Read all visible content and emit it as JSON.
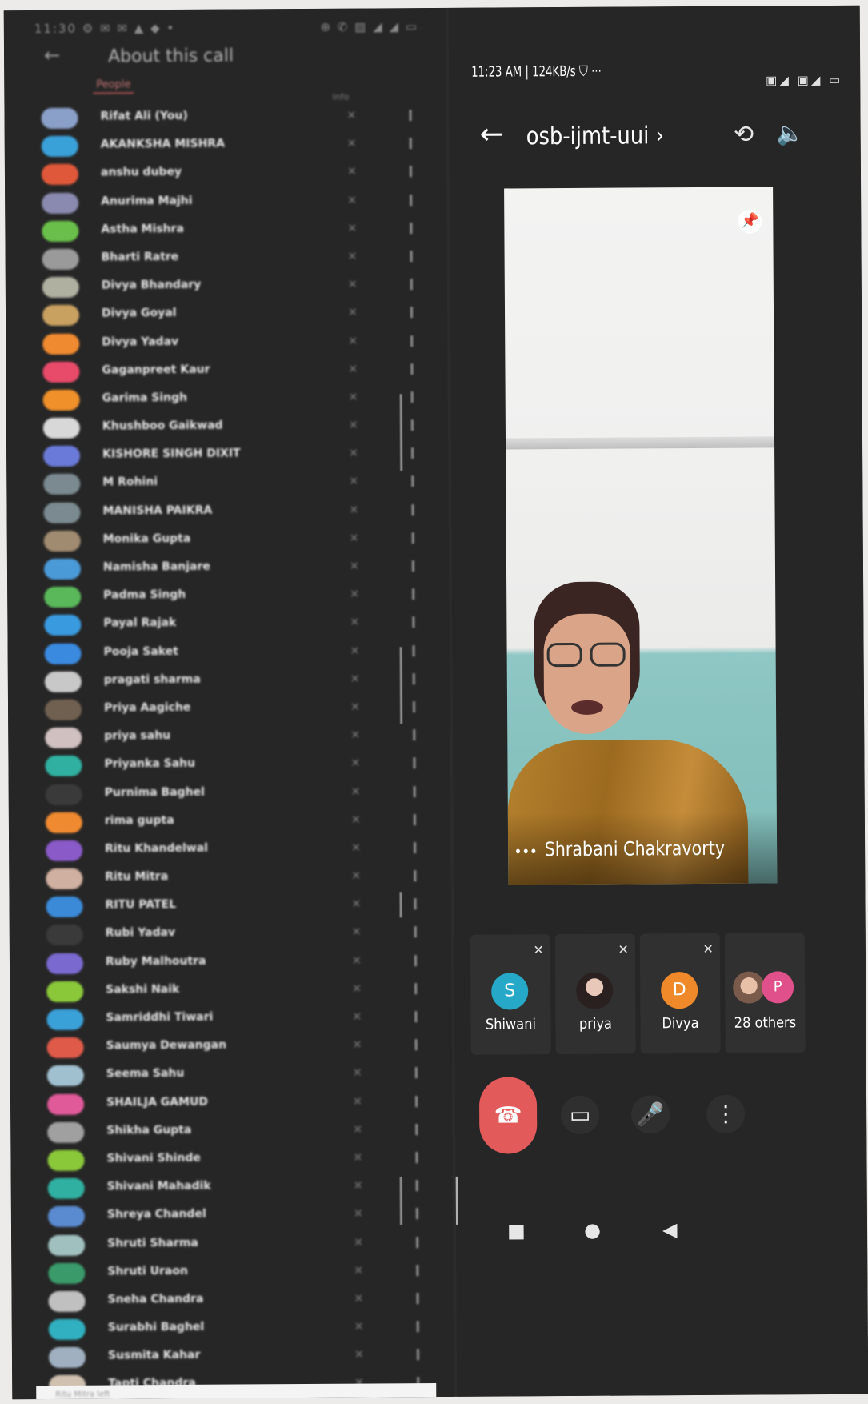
{
  "left_panel": {
    "status_bar": "11:30 ⚙ ✉ ✉ ▲ ◆ •",
    "status_icons": "⊕ ✆ ▨ ◢ ◢ ▭",
    "title": "About this call",
    "tab_people": "People",
    "tab_info": "Info",
    "footer": "Ritu Mitra left",
    "people": [
      {
        "name": "Rifat Ali (You)",
        "color": "#8aa0c8"
      },
      {
        "name": "AKANKSHA MISHRA",
        "color": "#3aa0d8"
      },
      {
        "name": "anshu dubey",
        "color": "#e0583a"
      },
      {
        "name": "Anurima Majhi",
        "color": "#8a8ab0"
      },
      {
        "name": "Astha Mishra",
        "color": "#6abf4a"
      },
      {
        "name": "Bharti Ratre",
        "color": "#9a9a9a"
      },
      {
        "name": "Divya Bhandary",
        "color": "#b0b0a0"
      },
      {
        "name": "Divya Goyal",
        "color": "#c8a060"
      },
      {
        "name": "Divya Yadav",
        "color": "#f08a30"
      },
      {
        "name": "Gaganpreet Kaur",
        "color": "#e84a6a"
      },
      {
        "name": "Garima Singh",
        "color": "#f0902a"
      },
      {
        "name": "Khushboo Gaikwad",
        "color": "#d8d8d8"
      },
      {
        "name": "KISHORE SINGH DIXIT",
        "color": "#6a7ad8"
      },
      {
        "name": "M Rohini",
        "color": "#7a8a90"
      },
      {
        "name": "MANISHA PAIKRA",
        "color": "#7a8a90"
      },
      {
        "name": "Monika Gupta",
        "color": "#a08a70"
      },
      {
        "name": "Namisha Banjare",
        "color": "#4a9ad8"
      },
      {
        "name": "Padma Singh",
        "color": "#5ab85a"
      },
      {
        "name": "Payal Rajak",
        "color": "#3a9ae0"
      },
      {
        "name": "Pooja Saket",
        "color": "#3a8ae0"
      },
      {
        "name": "pragati sharma",
        "color": "#c8c8c8"
      },
      {
        "name": "Priya Aagiche",
        "color": "#706050"
      },
      {
        "name": "priya sahu",
        "color": "#d0c0c0"
      },
      {
        "name": "Priyanka Sahu",
        "color": "#30b0a0"
      },
      {
        "name": "Purnima Baghel",
        "color": "#3a3a3a"
      },
      {
        "name": "rima gupta",
        "color": "#f08a30"
      },
      {
        "name": "Ritu Khandelwal",
        "color": "#8a5ac8"
      },
      {
        "name": "Ritu Mitra",
        "color": "#d0b0a0"
      },
      {
        "name": "RITU PATEL",
        "color": "#3a8ad8"
      },
      {
        "name": "Rubi Yadav",
        "color": "#3a3a3a"
      },
      {
        "name": "Ruby Malhoutra",
        "color": "#7a6ad0"
      },
      {
        "name": "Sakshi Naik",
        "color": "#8ac83a"
      },
      {
        "name": "Samriddhi Tiwari",
        "color": "#3aa0d8"
      },
      {
        "name": "Saumya Dewangan",
        "color": "#e05a4a"
      },
      {
        "name": "Seema Sahu",
        "color": "#a0c0d0"
      },
      {
        "name": "SHAILJA GAMUD",
        "color": "#e05a9a"
      },
      {
        "name": "Shikha Gupta",
        "color": "#a0a0a0"
      },
      {
        "name": "Shivani Shinde",
        "color": "#8ac83a"
      },
      {
        "name": "Shivani Mahadik",
        "color": "#30b0a0"
      },
      {
        "name": "Shreya Chandel",
        "color": "#5a8ad0"
      },
      {
        "name": "Shruti Sharma",
        "color": "#a0c0c0"
      },
      {
        "name": "Shruti Uraon",
        "color": "#3a9a6a"
      },
      {
        "name": "Sneha Chandra",
        "color": "#c0c0c0"
      },
      {
        "name": "Surabhi Baghel",
        "color": "#30b0c0"
      },
      {
        "name": "Susmita Kahar",
        "color": "#a0b0c0"
      },
      {
        "name": "Tapti Chandra",
        "color": "#d0c0b0"
      }
    ]
  },
  "right_panel": {
    "status_time": "11:23 AM | 124KB/s ⛉ ···",
    "status_icons": "▣◢ ▣◢ ▭",
    "meeting_code": "osb-ijmt-uui ›",
    "pinned_speaker": "Shrabani Chakravorty",
    "speaker_more": "•••",
    "participants": [
      {
        "name": "Shiwani",
        "initial": "S",
        "color": "#26a9c8"
      },
      {
        "name": "priya",
        "initial": "",
        "color": "#5a4a4a"
      },
      {
        "name": "Divya",
        "initial": "D",
        "color": "#f0892a"
      },
      {
        "name": "28 others",
        "initial": "P",
        "color": "#e0508a"
      }
    ]
  },
  "icons": {
    "back": "←",
    "camera_switch": "⟲",
    "speaker": "🔈",
    "pin": "📌",
    "mic_off": "✕",
    "hangup": "☎",
    "video": "▭",
    "mic": "🎤",
    "more": "⋮",
    "nav_square": "■",
    "nav_circle": "●",
    "nav_back": "◀"
  }
}
